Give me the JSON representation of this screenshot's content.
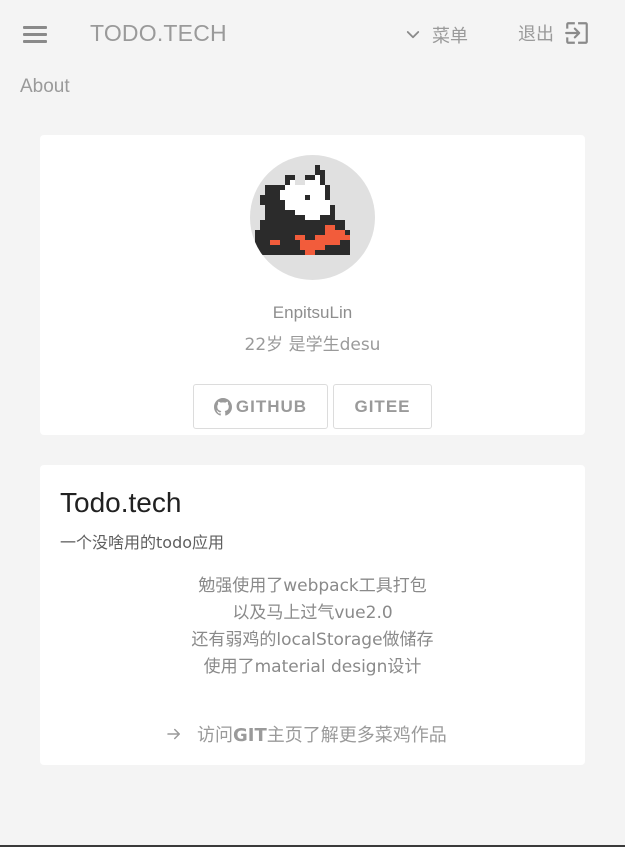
{
  "header": {
    "brand": "TODO.TECH",
    "menu_label": "菜单",
    "logout_label": "退出"
  },
  "page": {
    "title": "About"
  },
  "profile": {
    "name": "EnpitsuLin",
    "bio": "22岁 是学生desu",
    "buttons": {
      "github": "GITHUB",
      "gitee": "GITEE"
    }
  },
  "project": {
    "title": "Todo.tech",
    "subtitle": "一个没啥用的todo应用",
    "description": [
      "勉强使用了webpack工具打包",
      "以及马上过气vue2.0",
      "还有弱鸡的localStorage做储存",
      "使用了material design设计"
    ],
    "link": {
      "prefix": "访问",
      "bold": "GIT",
      "suffix": "主页了解更多菜鸡作品"
    }
  },
  "colors": {
    "background": "#f4f4f4",
    "card": "#ffffff",
    "text_muted": "#9a9a9a",
    "text_dark": "#212121",
    "avatar_bg": "#e0e0e0",
    "accent_scarf": "#f25c3b"
  },
  "icons": [
    "menu-icon",
    "chevron-down-icon",
    "logout-icon",
    "github-icon",
    "arrow-right-icon"
  ]
}
